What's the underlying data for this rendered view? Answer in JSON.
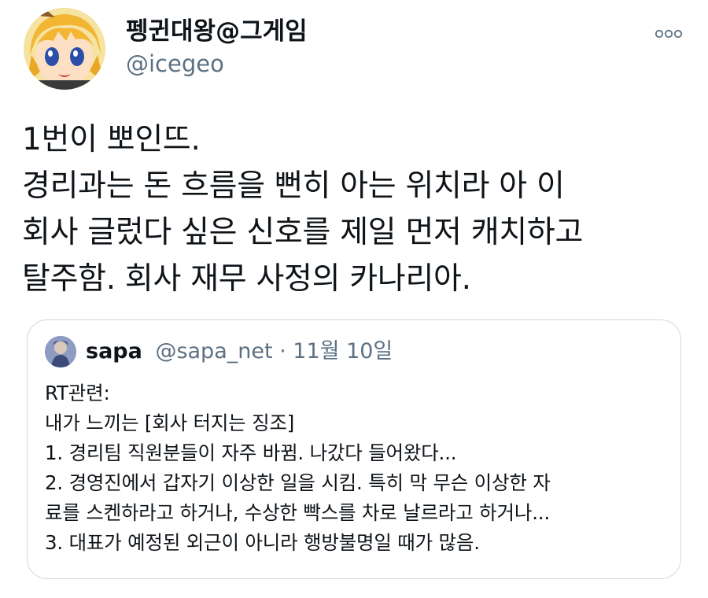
{
  "author": {
    "display_name": "펭귄대왕@그게임",
    "handle": "@icegeo",
    "avatar_icon": "anime-character-avatar"
  },
  "more_icon": "more-options-icon",
  "tweet": {
    "text": "1번이 뽀인뜨.\n경리과는 돈 흐름을 뻔히 아는 위치라 아 이\n회사 글렀다 싶은 신호를 제일 먼저 캐치하고\n탈주함. 회사 재무 사정의 카나리아."
  },
  "quoted": {
    "name": "sapa",
    "handle": "@sapa_net",
    "separator": " · ",
    "date": "11월 10일",
    "avatar_icon": "user-avatar",
    "text": "RT관련:\n내가 느끼는 [회사 터지는 징조]\n1. 경리팀 직원분들이 자주 바뀜. 나갔다 들어왔다...\n2. 경영진에서 갑자기 이상한 일을 시킴. 특히 막 무슨 이상한 자\n료를 스켄하라고 하거나, 수상한 빡스를 차로 날르라고 하거나...\n3. 대표가 예정된 외근이 아니라 행방불명일 때가 많음."
  },
  "colors": {
    "text": "#0f1419",
    "secondary": "#5b7083",
    "border": "#cfd9de"
  }
}
